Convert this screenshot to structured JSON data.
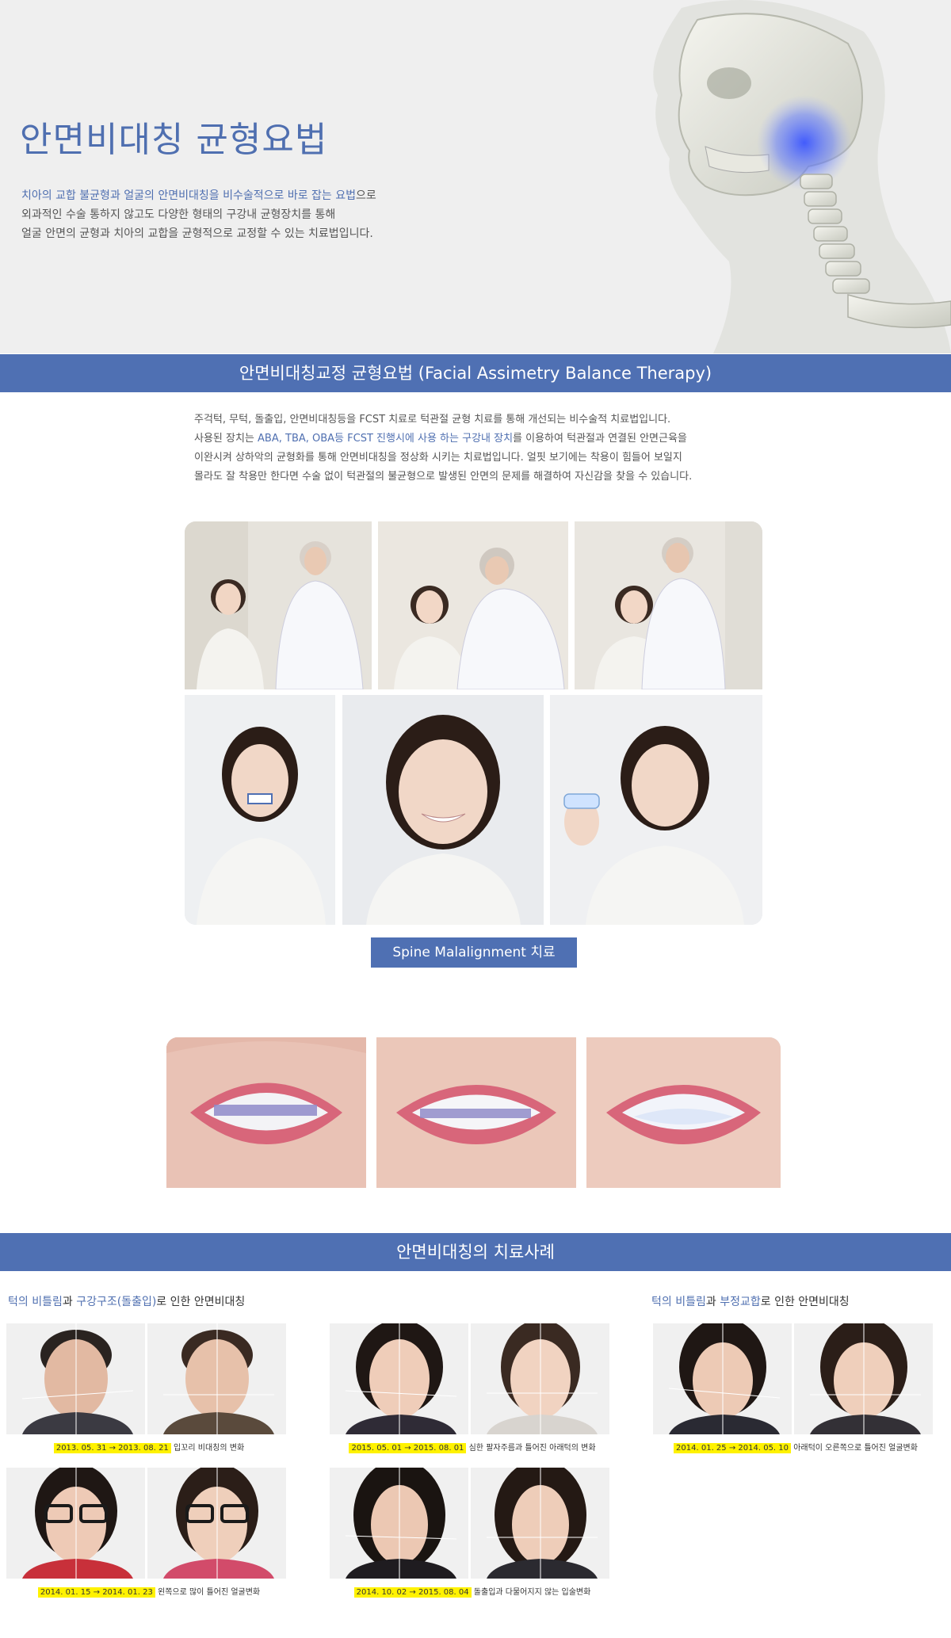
{
  "hero": {
    "title": "안면비대칭 균형요법",
    "desc_line1_highlight": "치아의 교합 불균형과 얼굴의 안면비대칭을 비수술적으로 바로 잡는 요법",
    "desc_line1_rest": "으로",
    "desc_line2": "외과적인 수술 통하지 않고도 다양한 형태의 구강내 균형장치를 통해",
    "desc_line3": "얼굴 안면의 균형과 치아의 교합을 균형적으로 교정할 수 있는 치료법입니다."
  },
  "section1": {
    "band_title": "안면비대칭교정 균형요법 (Facial Assimetry Balance Therapy)",
    "line1": "주걱턱, 무턱, 돌출입, 안면비대칭등을 FCST 치료로 턱관절 균형 치료를 통해 개선되는 비수술적 치료법입니다.",
    "line2_a": "사용된 장치는 ",
    "line2_highlight": "ABA, TBA, OBA등 FCST 진행시에 사용 하는 구강내 장치",
    "line2_b": "를 이용하여 턱관절과 연결된 안면근육을",
    "line3": "이완시켜 상하악의 균형화를 통해 안면비대칭을 정상화 시키는 치료법입니다. 얼핏 보기에는 착용이 힘들어 보일지",
    "line4": "몰라도 잘 착용만 한다면 수술 없이 턱관절의 불균형으로 발생된 안면의 문제를 해결하여 자신감을 찾을 수 있습니다."
  },
  "spine_button": "Spine Malalignment 치료",
  "section2": {
    "band_title": "안면비대칭의 치료사례",
    "heading_left": {
      "p1": "턱의 비틀림",
      "p2": "과 ",
      "p3": "구강구조(돌출입)",
      "p4": "로 인한 안면비대칭"
    },
    "heading_right": {
      "p1": "턱의 비틀림",
      "p2": "과 ",
      "p3": "부정교합",
      "p4": "로 인한 안면비대칭"
    },
    "cases": [
      {
        "date": "2013. 05. 31 → 2013. 08. 21",
        "text": "입꼬리 비대칭의 변화"
      },
      {
        "date": "2015. 05. 01 → 2015. 08. 01",
        "text": "심한 팔자주름과 틀어진 아래턱의 변화"
      },
      {
        "date": "2014. 01. 25 → 2014. 05. 10",
        "text": "아래턱이 오른쪽으로 틀어진 얼굴변화"
      },
      {
        "date": "2014. 01. 15 → 2014. 01. 23",
        "text": "왼쪽으로 많이 틀어진 얼굴변화"
      },
      {
        "date": "2014. 10. 02 → 2015. 08. 04",
        "text": "돌출입과 다물어지지 않는 입술변화"
      }
    ]
  },
  "colors": {
    "accent": "#4f70b3",
    "highlight": "#fff200",
    "hero_bg": "#efefef"
  }
}
